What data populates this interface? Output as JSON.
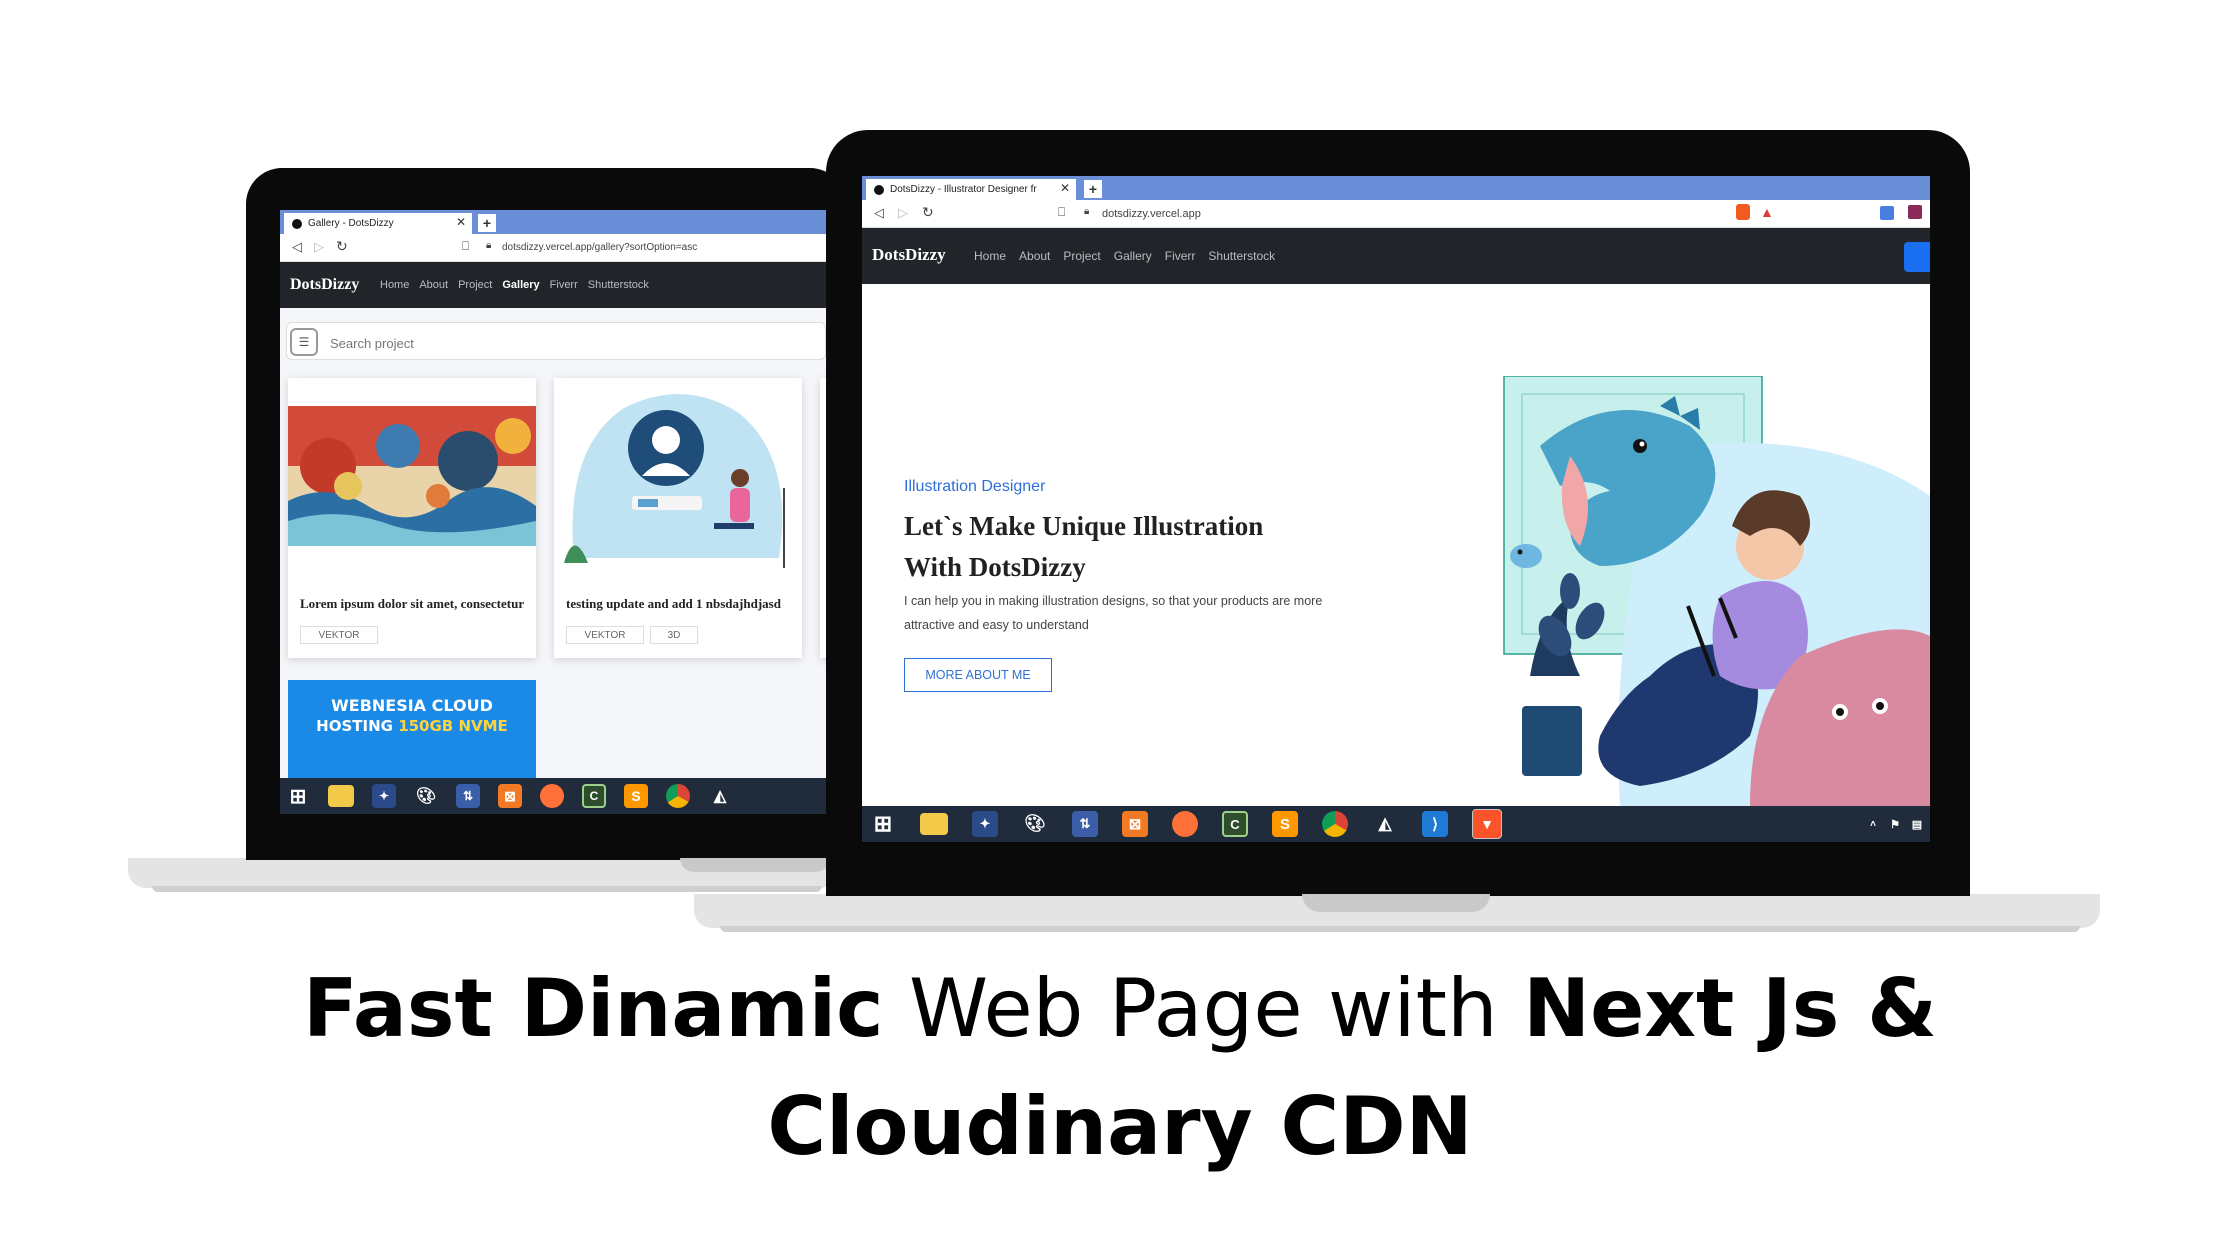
{
  "headline": {
    "part1": "Fast Dinamic",
    "part2": " Web Page with ",
    "part3": "Next Js &",
    "part4": "Cloudinary CDN"
  },
  "left_browser": {
    "tab_title": "Gallery - DotsDizzy",
    "url": "dotsdizzy.vercel.app/gallery?sortOption=asc",
    "brand": "DotsDizzy",
    "nav": [
      "Home",
      "About",
      "Project",
      "Gallery",
      "Fiverr",
      "Shutterstock"
    ],
    "active_nav": "Gallery",
    "search_placeholder": "Search project",
    "cards": [
      {
        "title": "Lorem ipsum dolor sit amet, consectetur",
        "tags": [
          "VEKTOR"
        ]
      },
      {
        "title": "testing update and add 1 nbsdajhdjasd",
        "tags": [
          "VEKTOR",
          "3D"
        ]
      }
    ],
    "ad": {
      "line1": "WEBNESIA CLOUD",
      "line2a": "HOSTING ",
      "line2b": "150GB NVME"
    }
  },
  "right_browser": {
    "tab_title": "DotsDizzy - Illustrator Designer fr",
    "url": "dotsdizzy.vercel.app",
    "brand": "DotsDizzy",
    "nav": [
      "Home",
      "About",
      "Project",
      "Gallery",
      "Fiverr",
      "Shutterstock"
    ],
    "hero": {
      "subtitle": "Illustration Designer",
      "title_line1": "Let`s Make Unique Illustration",
      "title_line2": "With DotsDizzy",
      "desc_line1": "I can help you in making illustration designs, so that your products are more",
      "desc_line2": "attractive and easy to understand",
      "button": "MORE ABOUT ME"
    }
  },
  "colors": {
    "tabbar": "#6a8fd8",
    "navbar": "#212529",
    "accent": "#2f6fd6",
    "taskbar": "#202b3c"
  }
}
